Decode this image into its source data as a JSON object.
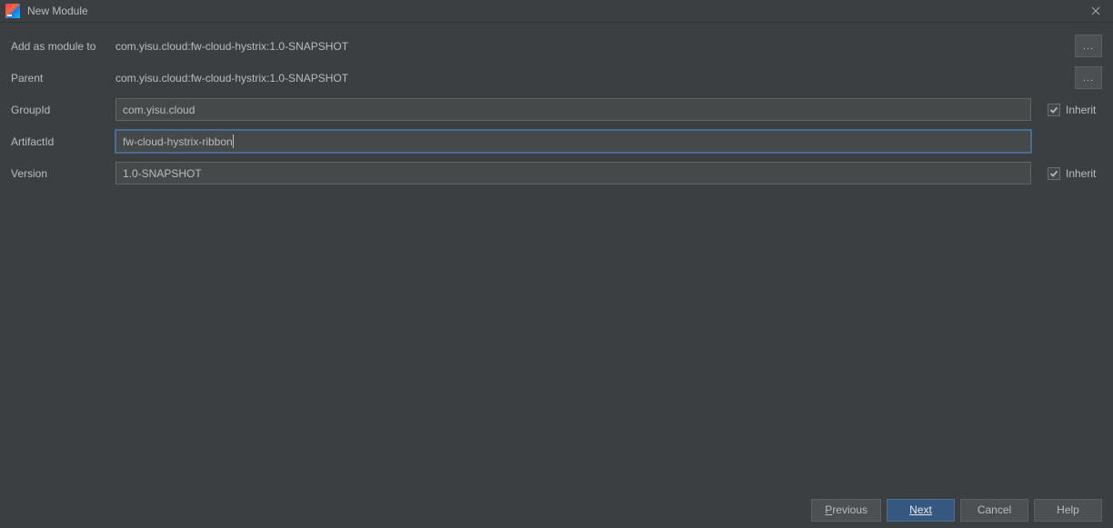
{
  "window": {
    "title": "New Module"
  },
  "form": {
    "addAsModule": {
      "label": "Add as module to",
      "value": "com.yisu.cloud:fw-cloud-hystrix:1.0-SNAPSHOT",
      "browse": "..."
    },
    "parent": {
      "label": "Parent",
      "value": "com.yisu.cloud:fw-cloud-hystrix:1.0-SNAPSHOT",
      "browse": "..."
    },
    "groupId": {
      "label": "GroupId",
      "value": "com.yisu.cloud",
      "inheritLabel": "Inherit",
      "inheritChecked": true
    },
    "artifactId": {
      "label": "ArtifactId",
      "value": "fw-cloud-hystrix-ribbon"
    },
    "version": {
      "label": "Version",
      "value": "1.0-SNAPSHOT",
      "inheritLabel": "Inherit",
      "inheritChecked": true
    }
  },
  "buttons": {
    "previous": "Previous",
    "next": "Next",
    "cancel": "Cancel",
    "help": "Help"
  }
}
